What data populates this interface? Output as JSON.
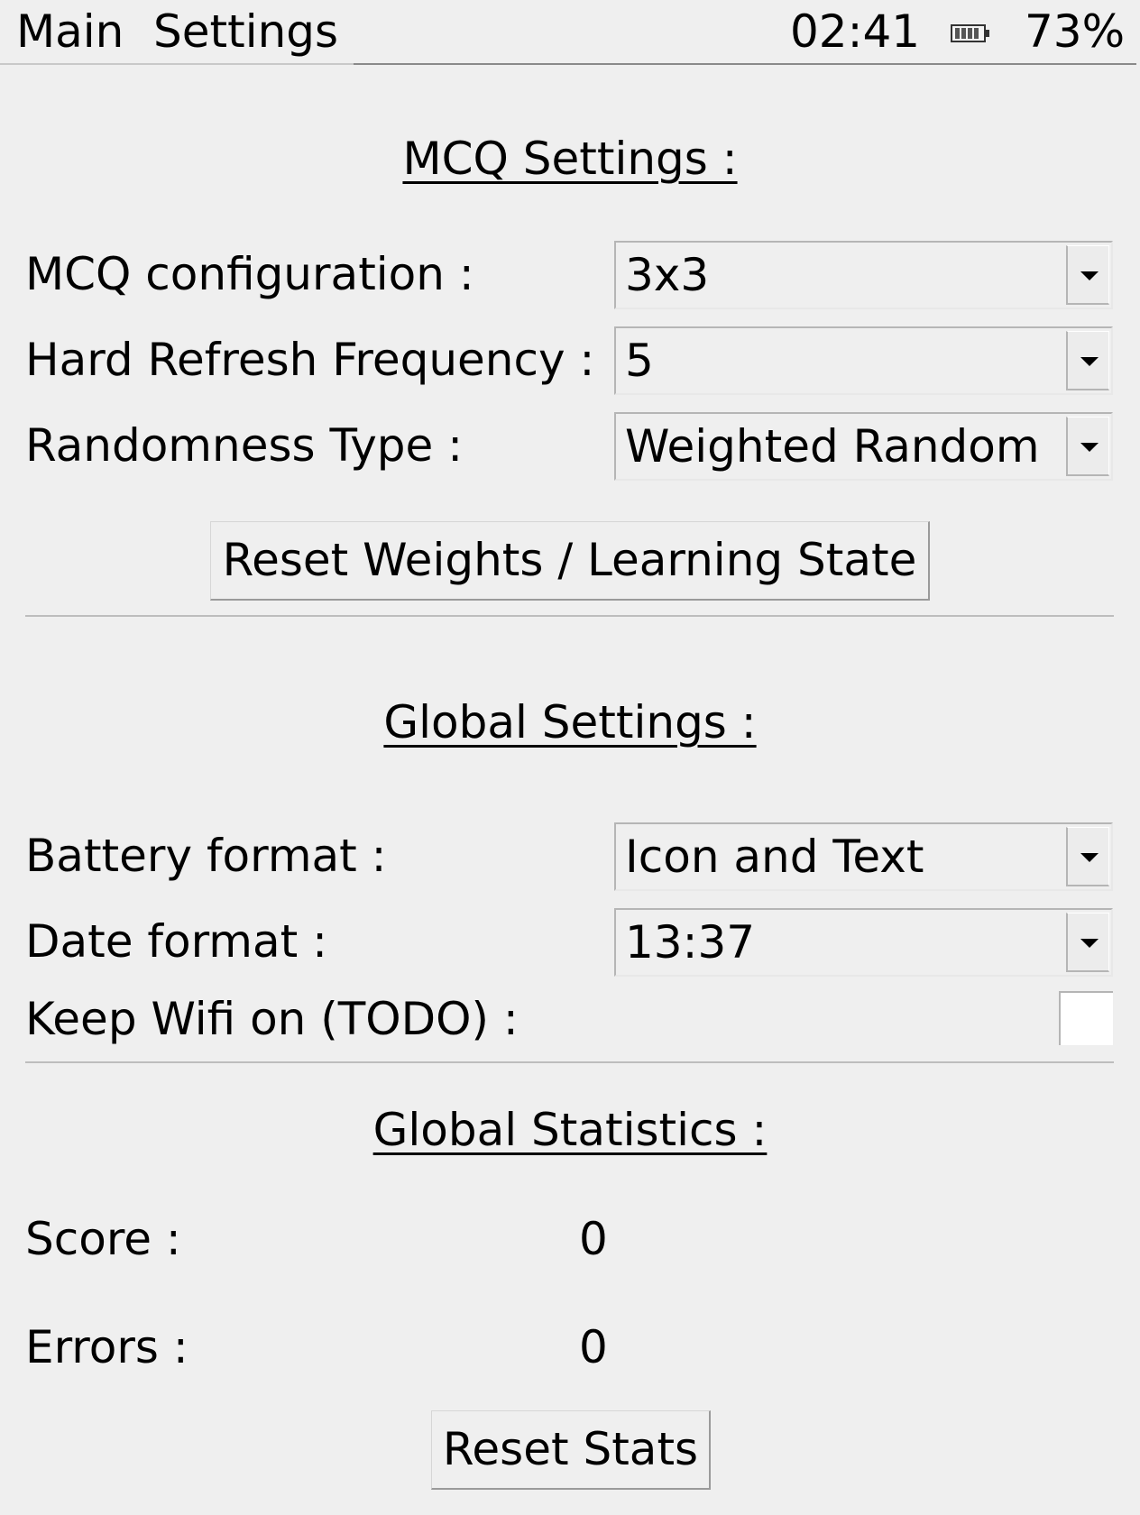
{
  "topbar": {
    "menu_main": "Main",
    "menu_settings": "Settings",
    "clock": "02:41",
    "battery_icon": "battery-icon",
    "battery_percent": "73%"
  },
  "mcq_section": {
    "heading": "MCQ Settings :",
    "config_label": "MCQ configuration :",
    "config_value": "3x3",
    "refresh_label": "Hard Refresh Frequency :",
    "refresh_value": "5",
    "randomness_label": "Randomness Type :",
    "randomness_value": "Weighted Random",
    "reset_weights_label": "Reset Weights / Learning State"
  },
  "global_section": {
    "heading": "Global Settings :",
    "battery_format_label": "Battery format :",
    "battery_format_value": "Icon and Text",
    "date_format_label": "Date format :",
    "date_format_value": "13:37",
    "wifi_label": "Keep Wifi on (TODO) :",
    "wifi_checked": false
  },
  "stats_section": {
    "heading": "Global Statistics :",
    "score_label": "Score :",
    "score_value": "0",
    "errors_label": "Errors :",
    "errors_value": "0",
    "reset_stats_label": "Reset Stats"
  },
  "icons": {
    "dropdown": "chevron-down-icon",
    "battery": "battery-icon"
  }
}
